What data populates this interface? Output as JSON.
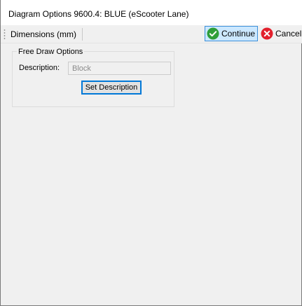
{
  "window": {
    "title": "Diagram Options 9600.4: BLUE (eScooter Lane)"
  },
  "toolbar": {
    "dimensions_label": "Dimensions (mm)",
    "continue_label": "Continue",
    "cancel_label": "Cancel",
    "continue_icon": "check-circle-icon",
    "cancel_icon": "x-circle-icon"
  },
  "free_draw": {
    "legend": "Free Draw Options",
    "description_label": "Description:",
    "description_value": "Block",
    "set_description_label": "Set Description"
  },
  "colors": {
    "continue_bg": "#cce8ff",
    "continue_border": "#3c8fd8",
    "check_green": "#2e9e3a",
    "cancel_red": "#e2202c",
    "focus_border": "#0078d7"
  }
}
